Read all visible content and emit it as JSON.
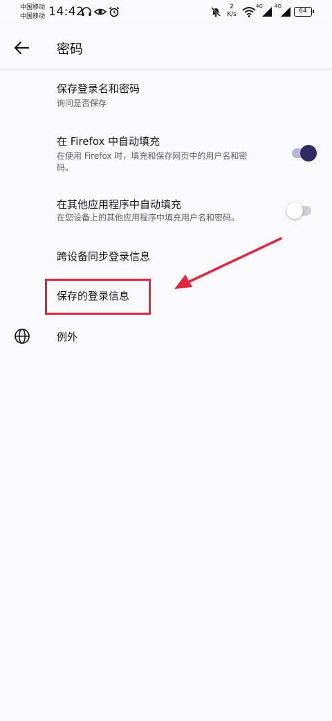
{
  "status_bar": {
    "carrier_1": "中国移动",
    "carrier_2": "中国移动",
    "time": "14:42",
    "speed_value": "2",
    "speed_unit": "K/s",
    "net_1": "4G",
    "net_2": "4G",
    "battery": "64"
  },
  "app_bar": {
    "title": "密码"
  },
  "settings": {
    "save_logins": {
      "title": "保存登录名和密码",
      "subtitle": "询问是否保存"
    },
    "autofill_firefox": {
      "title": "在 Firefox 中自动填充",
      "subtitle_line1": "在使用 Firefox 时，填充和保存网页中的用户名和密",
      "subtitle_line2": "码。",
      "enabled": true
    },
    "autofill_other_apps": {
      "title": "在其他应用程序中自动填充",
      "subtitle": "在您设备上的其他应用程序中填充用户名和密码。",
      "enabled": false
    },
    "sync_logins": {
      "title": "跨设备同步登录信息"
    },
    "saved_logins": {
      "title": "保存的登录信息"
    },
    "exceptions": {
      "title": "例外",
      "icon": "globe-icon"
    }
  },
  "colors": {
    "toggle_on_knob": "#312a65",
    "toggle_on_track": "#b9b5d9",
    "annotation_red": "#e0273e"
  }
}
